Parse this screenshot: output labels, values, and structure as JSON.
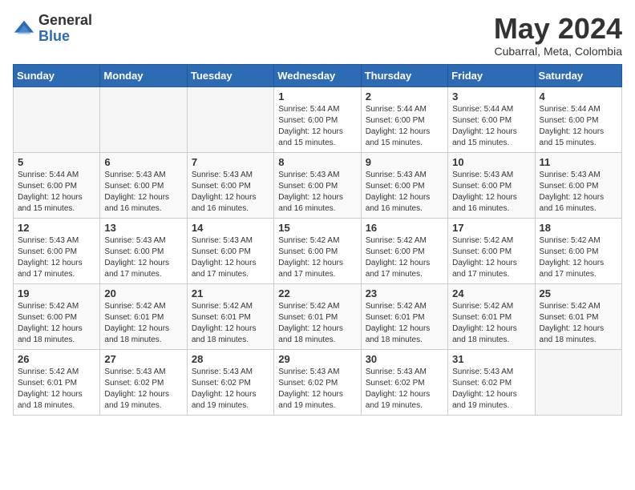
{
  "logo": {
    "general": "General",
    "blue": "Blue"
  },
  "title": "May 2024",
  "location": "Cubarral, Meta, Colombia",
  "weekdays": [
    "Sunday",
    "Monday",
    "Tuesday",
    "Wednesday",
    "Thursday",
    "Friday",
    "Saturday"
  ],
  "weeks": [
    [
      {
        "day": "",
        "sunrise": "",
        "sunset": "",
        "daylight": "",
        "empty": true
      },
      {
        "day": "",
        "sunrise": "",
        "sunset": "",
        "daylight": "",
        "empty": true
      },
      {
        "day": "",
        "sunrise": "",
        "sunset": "",
        "daylight": "",
        "empty": true
      },
      {
        "day": "1",
        "sunrise": "Sunrise: 5:44 AM",
        "sunset": "Sunset: 6:00 PM",
        "daylight": "Daylight: 12 hours and 15 minutes.",
        "empty": false
      },
      {
        "day": "2",
        "sunrise": "Sunrise: 5:44 AM",
        "sunset": "Sunset: 6:00 PM",
        "daylight": "Daylight: 12 hours and 15 minutes.",
        "empty": false
      },
      {
        "day": "3",
        "sunrise": "Sunrise: 5:44 AM",
        "sunset": "Sunset: 6:00 PM",
        "daylight": "Daylight: 12 hours and 15 minutes.",
        "empty": false
      },
      {
        "day": "4",
        "sunrise": "Sunrise: 5:44 AM",
        "sunset": "Sunset: 6:00 PM",
        "daylight": "Daylight: 12 hours and 15 minutes.",
        "empty": false
      }
    ],
    [
      {
        "day": "5",
        "sunrise": "Sunrise: 5:44 AM",
        "sunset": "Sunset: 6:00 PM",
        "daylight": "Daylight: 12 hours and 15 minutes.",
        "empty": false
      },
      {
        "day": "6",
        "sunrise": "Sunrise: 5:43 AM",
        "sunset": "Sunset: 6:00 PM",
        "daylight": "Daylight: 12 hours and 16 minutes.",
        "empty": false
      },
      {
        "day": "7",
        "sunrise": "Sunrise: 5:43 AM",
        "sunset": "Sunset: 6:00 PM",
        "daylight": "Daylight: 12 hours and 16 minutes.",
        "empty": false
      },
      {
        "day": "8",
        "sunrise": "Sunrise: 5:43 AM",
        "sunset": "Sunset: 6:00 PM",
        "daylight": "Daylight: 12 hours and 16 minutes.",
        "empty": false
      },
      {
        "day": "9",
        "sunrise": "Sunrise: 5:43 AM",
        "sunset": "Sunset: 6:00 PM",
        "daylight": "Daylight: 12 hours and 16 minutes.",
        "empty": false
      },
      {
        "day": "10",
        "sunrise": "Sunrise: 5:43 AM",
        "sunset": "Sunset: 6:00 PM",
        "daylight": "Daylight: 12 hours and 16 minutes.",
        "empty": false
      },
      {
        "day": "11",
        "sunrise": "Sunrise: 5:43 AM",
        "sunset": "Sunset: 6:00 PM",
        "daylight": "Daylight: 12 hours and 16 minutes.",
        "empty": false
      }
    ],
    [
      {
        "day": "12",
        "sunrise": "Sunrise: 5:43 AM",
        "sunset": "Sunset: 6:00 PM",
        "daylight": "Daylight: 12 hours and 17 minutes.",
        "empty": false
      },
      {
        "day": "13",
        "sunrise": "Sunrise: 5:43 AM",
        "sunset": "Sunset: 6:00 PM",
        "daylight": "Daylight: 12 hours and 17 minutes.",
        "empty": false
      },
      {
        "day": "14",
        "sunrise": "Sunrise: 5:43 AM",
        "sunset": "Sunset: 6:00 PM",
        "daylight": "Daylight: 12 hours and 17 minutes.",
        "empty": false
      },
      {
        "day": "15",
        "sunrise": "Sunrise: 5:42 AM",
        "sunset": "Sunset: 6:00 PM",
        "daylight": "Daylight: 12 hours and 17 minutes.",
        "empty": false
      },
      {
        "day": "16",
        "sunrise": "Sunrise: 5:42 AM",
        "sunset": "Sunset: 6:00 PM",
        "daylight": "Daylight: 12 hours and 17 minutes.",
        "empty": false
      },
      {
        "day": "17",
        "sunrise": "Sunrise: 5:42 AM",
        "sunset": "Sunset: 6:00 PM",
        "daylight": "Daylight: 12 hours and 17 minutes.",
        "empty": false
      },
      {
        "day": "18",
        "sunrise": "Sunrise: 5:42 AM",
        "sunset": "Sunset: 6:00 PM",
        "daylight": "Daylight: 12 hours and 17 minutes.",
        "empty": false
      }
    ],
    [
      {
        "day": "19",
        "sunrise": "Sunrise: 5:42 AM",
        "sunset": "Sunset: 6:00 PM",
        "daylight": "Daylight: 12 hours and 18 minutes.",
        "empty": false
      },
      {
        "day": "20",
        "sunrise": "Sunrise: 5:42 AM",
        "sunset": "Sunset: 6:01 PM",
        "daylight": "Daylight: 12 hours and 18 minutes.",
        "empty": false
      },
      {
        "day": "21",
        "sunrise": "Sunrise: 5:42 AM",
        "sunset": "Sunset: 6:01 PM",
        "daylight": "Daylight: 12 hours and 18 minutes.",
        "empty": false
      },
      {
        "day": "22",
        "sunrise": "Sunrise: 5:42 AM",
        "sunset": "Sunset: 6:01 PM",
        "daylight": "Daylight: 12 hours and 18 minutes.",
        "empty": false
      },
      {
        "day": "23",
        "sunrise": "Sunrise: 5:42 AM",
        "sunset": "Sunset: 6:01 PM",
        "daylight": "Daylight: 12 hours and 18 minutes.",
        "empty": false
      },
      {
        "day": "24",
        "sunrise": "Sunrise: 5:42 AM",
        "sunset": "Sunset: 6:01 PM",
        "daylight": "Daylight: 12 hours and 18 minutes.",
        "empty": false
      },
      {
        "day": "25",
        "sunrise": "Sunrise: 5:42 AM",
        "sunset": "Sunset: 6:01 PM",
        "daylight": "Daylight: 12 hours and 18 minutes.",
        "empty": false
      }
    ],
    [
      {
        "day": "26",
        "sunrise": "Sunrise: 5:42 AM",
        "sunset": "Sunset: 6:01 PM",
        "daylight": "Daylight: 12 hours and 18 minutes.",
        "empty": false
      },
      {
        "day": "27",
        "sunrise": "Sunrise: 5:43 AM",
        "sunset": "Sunset: 6:02 PM",
        "daylight": "Daylight: 12 hours and 19 minutes.",
        "empty": false
      },
      {
        "day": "28",
        "sunrise": "Sunrise: 5:43 AM",
        "sunset": "Sunset: 6:02 PM",
        "daylight": "Daylight: 12 hours and 19 minutes.",
        "empty": false
      },
      {
        "day": "29",
        "sunrise": "Sunrise: 5:43 AM",
        "sunset": "Sunset: 6:02 PM",
        "daylight": "Daylight: 12 hours and 19 minutes.",
        "empty": false
      },
      {
        "day": "30",
        "sunrise": "Sunrise: 5:43 AM",
        "sunset": "Sunset: 6:02 PM",
        "daylight": "Daylight: 12 hours and 19 minutes.",
        "empty": false
      },
      {
        "day": "31",
        "sunrise": "Sunrise: 5:43 AM",
        "sunset": "Sunset: 6:02 PM",
        "daylight": "Daylight: 12 hours and 19 minutes.",
        "empty": false
      },
      {
        "day": "",
        "sunrise": "",
        "sunset": "",
        "daylight": "",
        "empty": true
      }
    ]
  ]
}
